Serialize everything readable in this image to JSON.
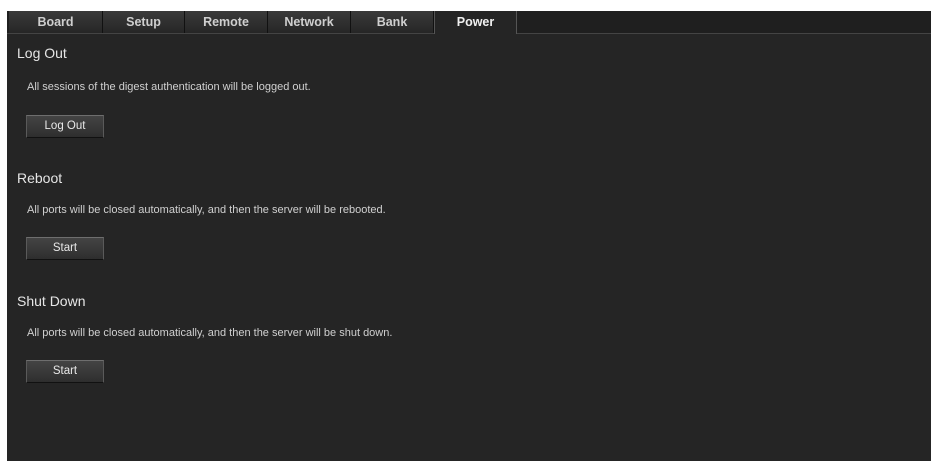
{
  "tabs": [
    {
      "label": "Board"
    },
    {
      "label": "Setup"
    },
    {
      "label": "Remote"
    },
    {
      "label": "Network"
    },
    {
      "label": "Bank"
    },
    {
      "label": "Power",
      "active": true
    }
  ],
  "sections": {
    "logout": {
      "title": "Log Out",
      "description": "All sessions of the digest authentication will be logged out.",
      "button": "Log Out"
    },
    "reboot": {
      "title": "Reboot",
      "description": "All ports will be closed automatically, and then the server will be rebooted.",
      "button": "Start"
    },
    "shutdown": {
      "title": "Shut Down",
      "description": "All ports will be closed automatically, and then the server will be shut down.",
      "button": "Start"
    }
  }
}
